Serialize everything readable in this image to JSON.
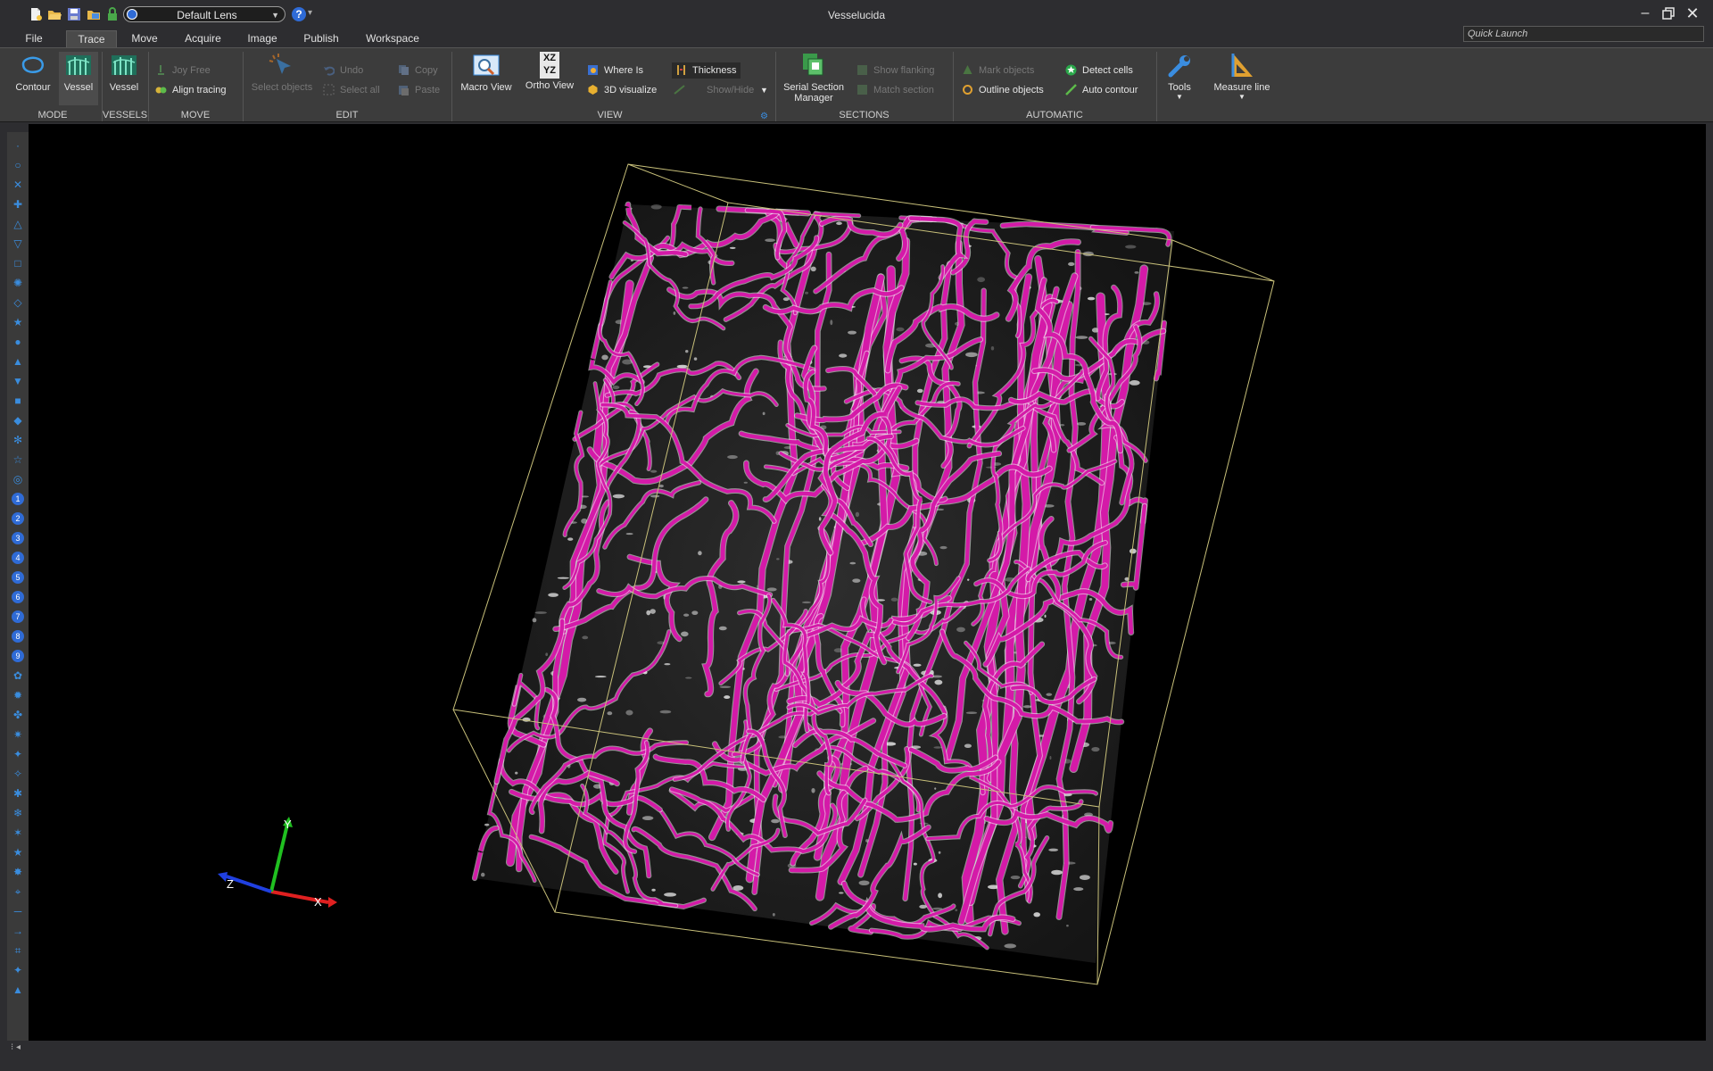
{
  "window": {
    "title": "Vesselucida",
    "minimize_icon": "minimize-icon",
    "maximize_icon": "restore-icon",
    "close_icon": "close-icon"
  },
  "quick_access": {
    "lens": "Default Lens",
    "icons": [
      "new-file-icon",
      "open-folder-icon",
      "save-icon",
      "open-image-icon",
      "lock-icon"
    ],
    "help_label": "?"
  },
  "quick_launch": {
    "placeholder": "Quick Launch"
  },
  "menu": {
    "tabs": [
      "File",
      "Trace",
      "Move",
      "Acquire",
      "Image",
      "Publish",
      "Workspace"
    ],
    "active": "Trace"
  },
  "ribbon": {
    "groups": {
      "mode": "MODE",
      "vessels": "VESSELS",
      "move": "MOVE",
      "edit": "EDIT",
      "view": "VIEW",
      "sections": "SECTIONS",
      "automatic": "AUTOMATIC"
    },
    "mode": {
      "contour": "Contour",
      "vessel": "Vessel"
    },
    "vessels": {
      "vessel": "Vessel"
    },
    "move": {
      "joy_free": "Joy Free",
      "align_tracing": "Align tracing"
    },
    "edit": {
      "select_objects": "Select objects",
      "undo": "Undo",
      "select_all": "Select all",
      "copy": "Copy",
      "paste": "Paste"
    },
    "view": {
      "macro_view": "Macro View",
      "ortho_view": "Ortho View",
      "ortho_icon_top": "XZ",
      "ortho_icon_bottom": "YZ",
      "where_is": "Where Is",
      "visualize_3d": "3D visualize",
      "thickness": "Thickness",
      "show_hide": "Show/Hide"
    },
    "sections": {
      "serial_section_manager_1": "Serial Section",
      "serial_section_manager_2": "Manager",
      "show_flanking": "Show flanking",
      "match_section": "Match section"
    },
    "automatic": {
      "mark_objects": "Mark objects",
      "outline_objects": "Outline objects",
      "detect_cells": "Detect cells",
      "auto_contour": "Auto contour"
    },
    "tools": {
      "tools": "Tools",
      "measure_line": "Measure line"
    }
  },
  "left_toolbar": {
    "icons": [
      "dot",
      "circle",
      "x",
      "cross",
      "triangle",
      "triangle-down",
      "square",
      "gear",
      "diamond",
      "star",
      "circle-filled",
      "triangle-filled",
      "triangle-down-filled",
      "square-filled",
      "diamond-filled",
      "snowflake",
      "star-outline",
      "target",
      "1",
      "2",
      "3",
      "4",
      "5",
      "6",
      "7",
      "8",
      "9",
      "flower",
      "sun",
      "clover",
      "burst",
      "sparkle",
      "plus-star",
      "asterisk",
      "snow",
      "star-6",
      "star-filled",
      "burst-2",
      "crosshair",
      "line",
      "arrow",
      "hash",
      "four-point",
      "pyramid"
    ],
    "numbers": [
      "1",
      "2",
      "3",
      "4",
      "5",
      "6",
      "7",
      "8",
      "9"
    ]
  },
  "viewport": {
    "axes": {
      "x": "X",
      "y": "Y",
      "z": "Z"
    },
    "colors": {
      "vessel": "#d41aa8",
      "box": "#c8c07a",
      "x_axis": "#e02020",
      "y_axis": "#20c020",
      "z_axis": "#2040e0"
    }
  }
}
